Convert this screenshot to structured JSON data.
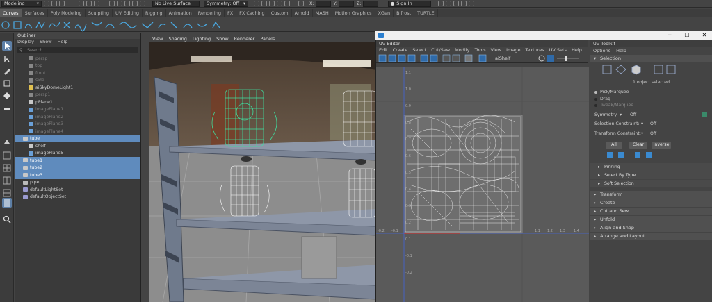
{
  "status_bar": {
    "workspace": "Modeling",
    "live_surface": "No Live Surface",
    "symmetry": "Symmetry: Off",
    "x_label": "X:",
    "y_label": "Y:",
    "z_label": "Z:",
    "sign_in": "Sign In"
  },
  "shelf_tabs": [
    "Curves",
    "Surfaces",
    "Poly Modeling",
    "Sculpting",
    "UV Editing",
    "Rigging",
    "Animation",
    "Rendering",
    "FX",
    "FX Caching",
    "Custom",
    "Arnold",
    "MASH",
    "Motion Graphics",
    "XGen",
    "Bifrost",
    "TURTLE"
  ],
  "outliner": {
    "title": "Outliner",
    "menu": [
      "Display",
      "Show",
      "Help"
    ],
    "search_placeholder": "Search...",
    "items": [
      {
        "label": "persp",
        "dim": true,
        "selected": false,
        "icon": "camera-icon"
      },
      {
        "label": "top",
        "dim": true,
        "selected": false,
        "icon": "camera-icon"
      },
      {
        "label": "front",
        "dim": true,
        "selected": false,
        "icon": "camera-icon"
      },
      {
        "label": "side",
        "dim": true,
        "selected": false,
        "icon": "camera-icon"
      },
      {
        "label": "aiSkyDomeLight1",
        "dim": false,
        "selected": false,
        "icon": "light-icon"
      },
      {
        "label": "persp1",
        "dim": true,
        "selected": false,
        "icon": "camera-icon"
      },
      {
        "label": "pPlane1",
        "dim": false,
        "selected": false,
        "icon": "mesh-icon"
      },
      {
        "label": "imagePlane1",
        "dim": true,
        "selected": false,
        "icon": "image-plane-icon"
      },
      {
        "label": "imagePlane2",
        "dim": true,
        "selected": false,
        "icon": "image-plane-icon"
      },
      {
        "label": "imagePlane3",
        "dim": true,
        "selected": false,
        "icon": "image-plane-icon"
      },
      {
        "label": "imagePlane4",
        "dim": true,
        "selected": false,
        "icon": "image-plane-icon"
      },
      {
        "label": "tube",
        "dim": false,
        "selected": true,
        "icon": "mesh-icon"
      },
      {
        "label": "shelf",
        "dim": false,
        "selected": false,
        "icon": "mesh-icon"
      },
      {
        "label": "imagePlane5",
        "dim": false,
        "selected": false,
        "icon": "image-plane-icon"
      },
      {
        "label": "tube1",
        "dim": false,
        "selected": true,
        "icon": "mesh-icon"
      },
      {
        "label": "tube2",
        "dim": false,
        "selected": true,
        "icon": "mesh-icon"
      },
      {
        "label": "tube3",
        "dim": false,
        "selected": true,
        "icon": "mesh-icon"
      },
      {
        "label": "pipe",
        "dim": false,
        "selected": false,
        "icon": "group-icon"
      },
      {
        "label": "defaultLightSet",
        "dim": false,
        "selected": false,
        "icon": "set-icon"
      },
      {
        "label": "defaultObjectSet",
        "dim": false,
        "selected": false,
        "icon": "set-icon"
      }
    ]
  },
  "viewport": {
    "menu": [
      "View",
      "Shading",
      "Lighting",
      "Show",
      "Renderer",
      "Panels"
    ]
  },
  "uv_editor": {
    "title": "UV Editor",
    "menu": [
      "Edit",
      "Create",
      "Select",
      "Cut/Sew",
      "Modify",
      "Tools",
      "View",
      "Image",
      "Textures",
      "UV Sets",
      "Help"
    ],
    "texture_name": "aiShelf",
    "axis_labels_v": [
      "1.1",
      "1.0",
      "0.9",
      "0.8",
      "0.7",
      "0.6",
      "0.5",
      "0.4",
      "0.3",
      "0.2",
      "0.1",
      "-0.1",
      "-0.2"
    ],
    "axis_labels_u": [
      "-0.2",
      "-0.1",
      "1.1",
      "1.2",
      "1.3",
      "1.4"
    ]
  },
  "uv_toolkit": {
    "title": "UV Toolkit",
    "menu": [
      "Options",
      "Help"
    ],
    "selection_header": "Selection",
    "selected_text": "1 object selected",
    "radios": [
      {
        "label": "Pick/Marquee",
        "dim": false
      },
      {
        "label": "Drag",
        "dim": false
      },
      {
        "label": "Tweak/Marquee",
        "dim": true
      }
    ],
    "symmetry_label": "Symmetry:",
    "symmetry_value": "Off",
    "selection_constraint_label": "Selection Constraint:",
    "selection_constraint_value": "Off",
    "transform_constraint_label": "Transform Constraint:",
    "transform_constraint_value": "Off",
    "buttons": [
      "All",
      "Clear",
      "Inverse"
    ],
    "subsections": [
      "Pinning",
      "Select By Type",
      "Soft Selection"
    ],
    "sections": [
      "Transform",
      "Create",
      "Cut and Sew",
      "Unfold",
      "Align and Snap",
      "Arrange and Layout"
    ]
  },
  "colors": {
    "selection": "#5f8bbd",
    "wire_selected": "#3fe0a0",
    "wire": "#ffffff"
  }
}
